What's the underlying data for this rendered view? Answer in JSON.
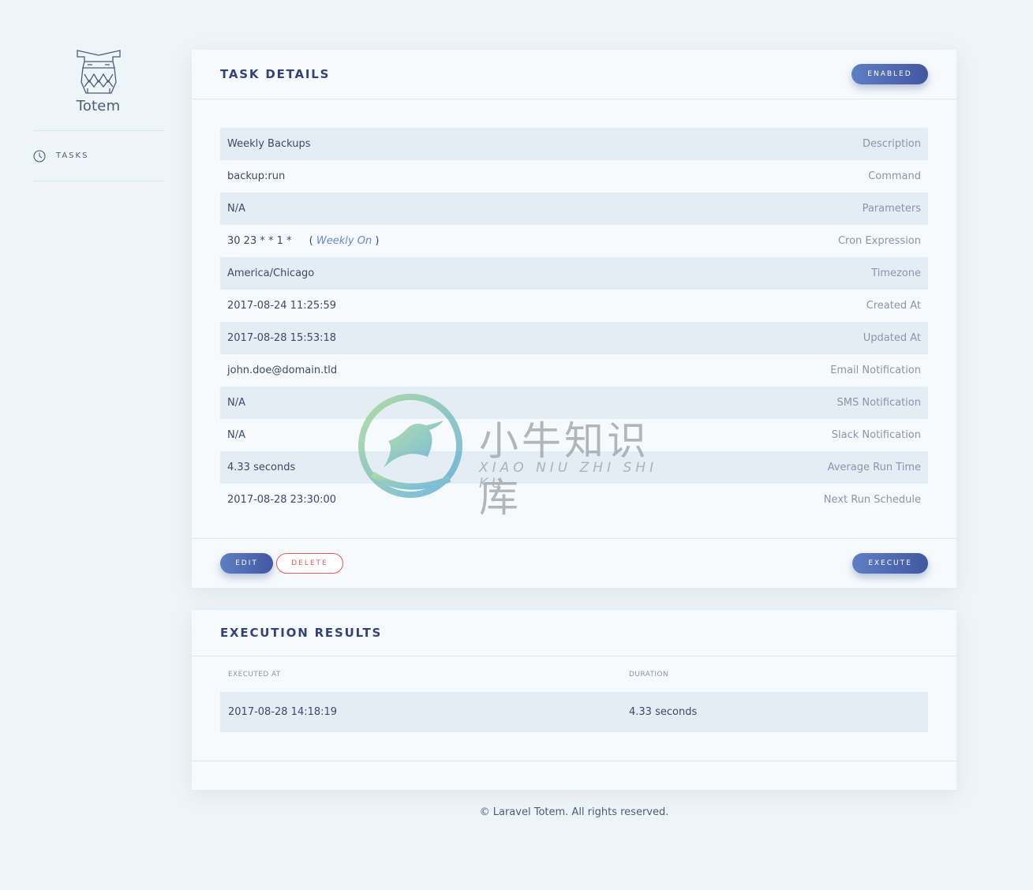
{
  "brand": {
    "name": "Totem"
  },
  "sidebar": {
    "items": [
      {
        "label": "TASKS",
        "icon": "clock-icon"
      }
    ]
  },
  "task_details": {
    "title": "TASK DETAILS",
    "status_label": "ENABLED",
    "rows": [
      {
        "value": "Weekly Backups",
        "label": "Description"
      },
      {
        "value": "backup:run",
        "label": "Command"
      },
      {
        "value": "N/A",
        "label": "Parameters"
      },
      {
        "value": "30 23 * * 1 *",
        "label": "Cron Expression",
        "human": "Weekly On"
      },
      {
        "value": "America/Chicago",
        "label": "Timezone"
      },
      {
        "value": "2017-08-24 11:25:59",
        "label": "Created At"
      },
      {
        "value": "2017-08-28 15:53:18",
        "label": "Updated At"
      },
      {
        "value": "john.doe@domain.tld",
        "label": "Email Notification"
      },
      {
        "value": "N/A",
        "label": "SMS Notification"
      },
      {
        "value": "N/A",
        "label": "Slack Notification"
      },
      {
        "value": "4.33 seconds",
        "label": "Average Run Time"
      },
      {
        "value": "2017-08-28 23:30:00",
        "label": "Next Run Schedule"
      }
    ],
    "edit_label": "EDIT",
    "delete_label": "DELETE",
    "execute_label": "EXECUTE"
  },
  "execution_results": {
    "title": "EXECUTION RESULTS",
    "columns": [
      "EXECUTED AT",
      "DURATION"
    ],
    "rows": [
      {
        "executed_at": "2017-08-28 14:18:19",
        "duration": "4.33 seconds"
      }
    ]
  },
  "footer": {
    "copyright": "© Laravel Totem. All rights reserved."
  },
  "watermark": {
    "cn": "小牛知识库",
    "en": "XIAO NIU ZHI SHI KU"
  },
  "colors": {
    "background": "#eef5f9",
    "accent": "#4258a0",
    "danger": "#e45b5b",
    "row_stripe": "#e4ecf4"
  }
}
